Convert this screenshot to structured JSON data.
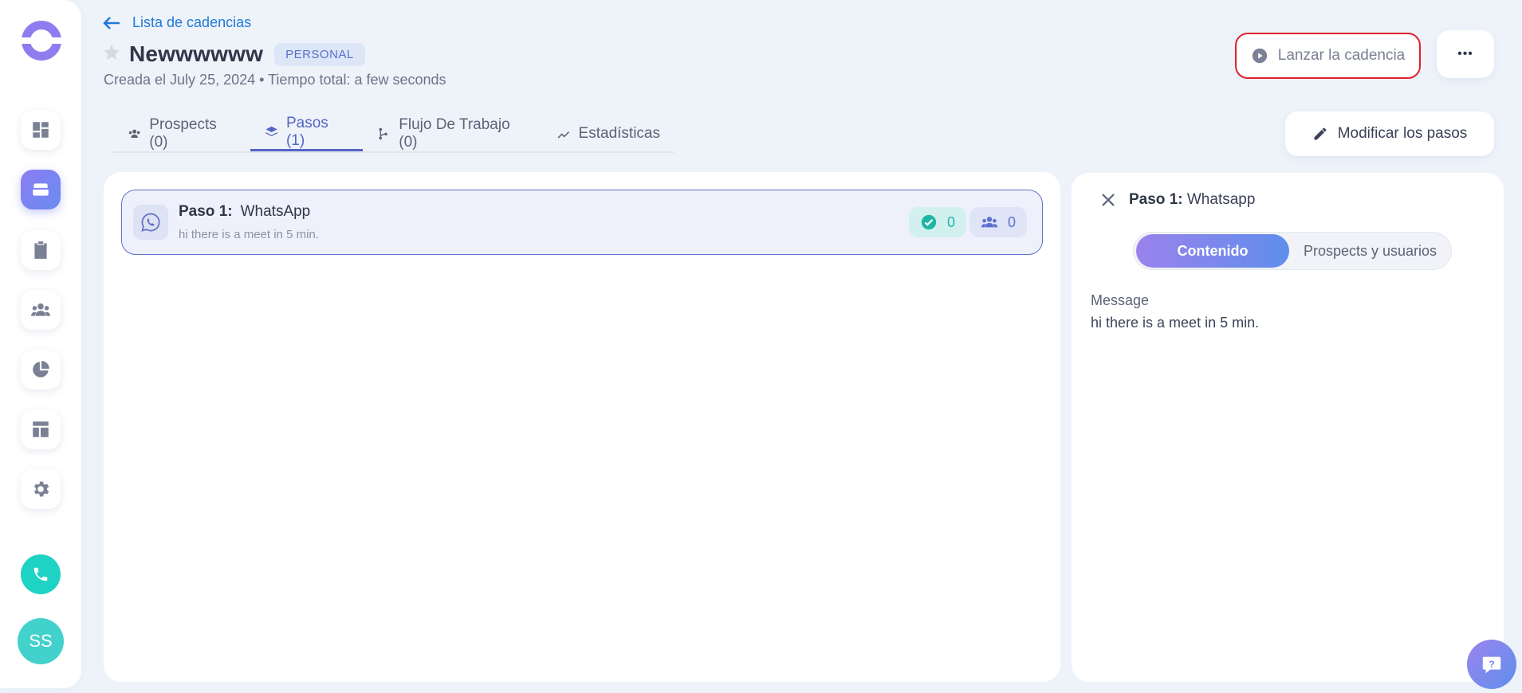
{
  "app": {
    "accent": "#5565c4",
    "launch_border_color": "#e0202a"
  },
  "sidebar": {
    "items": [
      {
        "name": "dashboard-icon"
      },
      {
        "name": "cadences-icon",
        "active": true
      },
      {
        "name": "tasks-icon"
      },
      {
        "name": "contacts-icon"
      },
      {
        "name": "analytics-icon"
      },
      {
        "name": "templates-icon"
      },
      {
        "name": "settings-icon"
      }
    ],
    "avatar_initials": "SS"
  },
  "header": {
    "back_label": "Lista de cadencias",
    "title": "Newwwwww",
    "badge": "PERSONAL",
    "subtitle": "Creada el July 25, 2024 • Tiempo total: a few seconds",
    "launch_label": "Lanzar la cadencia",
    "more_label": "•••"
  },
  "tabs": [
    {
      "label": "Prospects (0)",
      "icon": "people-icon"
    },
    {
      "label": "Pasos (1)",
      "icon": "layers-icon",
      "active": true
    },
    {
      "label": "Flujo De Trabajo (0)",
      "icon": "branch-icon"
    },
    {
      "label": "Estadísticas",
      "icon": "trend-icon"
    }
  ],
  "edit_steps_label": "Modificar los pasos",
  "steps": [
    {
      "prefix": "Paso 1:",
      "type": "WhatsApp",
      "preview": "hi there is a meet in 5 min.",
      "done_count": "0",
      "people_count": "0"
    }
  ],
  "detail": {
    "prefix": "Paso 1:",
    "type": "Whatsapp",
    "segments": [
      "Contenido",
      "Prospects y usuarios"
    ],
    "message_label": "Message",
    "message_text": "hi there is a meet in 5 min."
  }
}
